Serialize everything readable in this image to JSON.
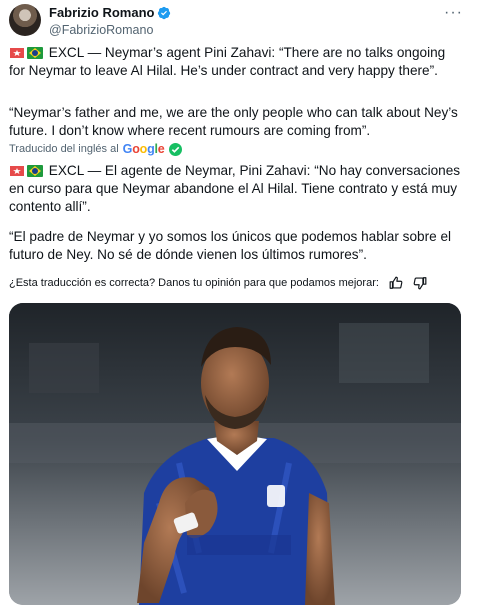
{
  "author": {
    "display_name": "Fabrizio Romano",
    "handle": "@FabrizioRomano",
    "verified_icon": "verified-badge-icon"
  },
  "tweet": {
    "original_line1": "EXCL — Neymar’s agent Pini Zahavi: “There are no talks ongoing for Neymar to leave Al Hilal. He’s under contract and very happy there”.",
    "original_line2": "“Neymar’s father and me, we are the only people who can talk about Ney’s future. I don’t know where recent rumours are coming from”.",
    "translated_label": "Traducido del inglés al",
    "translated_brand": "Google",
    "translation_line1": "EXCL — El agente de Neymar, Pini Zahavi: “No hay conversaciones en curso para que Neymar abandone el Al Hilal. Tiene contrato y está muy contento allí”.",
    "translation_line2": "“El padre de Neymar y yo somos los únicos que podemos hablar sobre el futuro de Ney. No sé de dónde vienen los últimos rumores”."
  },
  "feedback": {
    "question": "¿Esta traducción es correcta? Danos tu opinión para que podamos mejorar:"
  },
  "colors": {
    "text": "#0f1419",
    "secondary": "#536471",
    "verified": "#1d9bf0",
    "check": "#17bf63",
    "kit_blue": "#1e3fa0"
  }
}
